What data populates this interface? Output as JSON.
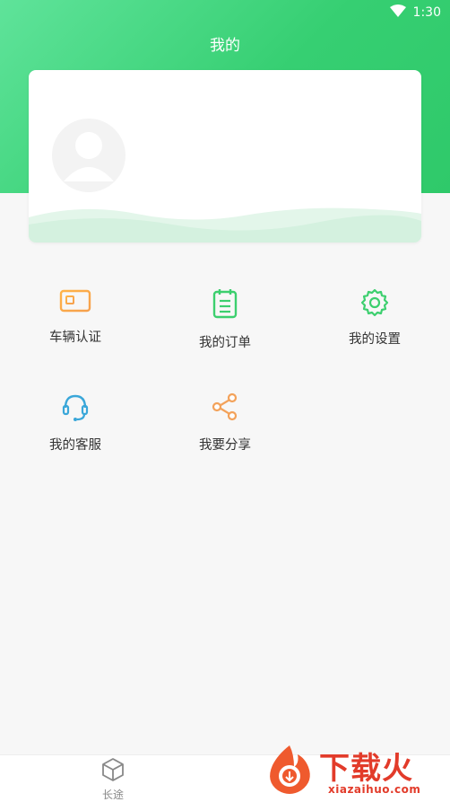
{
  "status_bar": {
    "time": "1:30",
    "wifi_icon": "wifi-icon"
  },
  "header": {
    "title": "我的"
  },
  "profile_card": {
    "avatar_icon": "avatar-placeholder-icon"
  },
  "menu": [
    {
      "label": "车辆认证",
      "icon": "id-card-icon"
    },
    {
      "label": "我的订单",
      "icon": "clipboard-icon"
    },
    {
      "label": "我的设置",
      "icon": "gear-icon"
    },
    {
      "label": "我的客服",
      "icon": "headset-icon"
    },
    {
      "label": "我要分享",
      "icon": "share-icon"
    }
  ],
  "tabbar": {
    "items": [
      {
        "label": "长途",
        "icon": "cube-icon"
      }
    ]
  },
  "watermark": {
    "title": "下载火",
    "subtitle": "xiazaihuo.com"
  },
  "colors": {
    "header_start": "#5fe39a",
    "header_end": "#2fc96a",
    "background": "#f7f7f7"
  }
}
